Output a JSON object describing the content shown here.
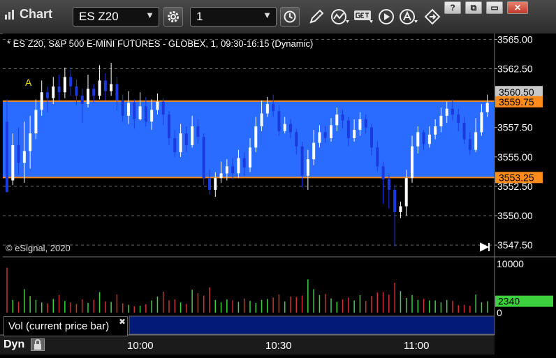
{
  "app": {
    "title": "Chart"
  },
  "toolbar": {
    "symbol": "ES Z20",
    "interval": "1"
  },
  "window_controls": [
    "?",
    "⧉",
    "▭",
    "✕"
  ],
  "chart": {
    "header": "* ES Z20, S&P 500 E-MINI FUTURES - GLOBEX, 1, 09:30-16:15 (Dynamic)",
    "copyright": "© eSignal, 2020",
    "marker_label": "A",
    "price_ticks": [
      "3565.00",
      "3562.50",
      "3557.50",
      "3555.00",
      "3552.50",
      "3550.00",
      "3547.50"
    ],
    "price_tick_values": [
      3565.0,
      3562.5,
      3557.5,
      3555.0,
      3552.5,
      3550.0,
      3547.5
    ],
    "badges": {
      "last": {
        "text": "3560.50",
        "value": 3560.5
      },
      "upper": {
        "text": "3559.75",
        "value": 3559.75
      },
      "lower": {
        "text": "3553.25",
        "value": 3553.25
      }
    },
    "band": {
      "high": 3559.75,
      "low": 3553.25,
      "color": "#2a6cff",
      "border_color": "#ff8c1a"
    },
    "colors": {
      "up": "#ffffff",
      "down": "#1a3ae0",
      "vol_up": "#3ed13e",
      "vol_down": "#d03030",
      "volume_badge": "#3ed13e"
    },
    "volume": {
      "label": "Vol (current price bar)",
      "scale_top": "10000",
      "scale_bottom": "0",
      "current": "2340",
      "current_value": 2340
    },
    "time_labels": [
      "10:00",
      "10:30",
      "11:00"
    ],
    "dyn_label": "Dyn"
  },
  "chart_data": {
    "type": "candlestick",
    "y_range": [
      3546.5,
      3565.5
    ],
    "bars": [
      [
        3558,
        3552,
        3559.9,
        3553
      ],
      [
        3553,
        3556,
        3557,
        3552.6
      ],
      [
        3556,
        3554.5,
        3557.5,
        3553.5
      ],
      [
        3554.5,
        3555.5,
        3558,
        3552.8
      ],
      [
        3555.5,
        3557,
        3558.5,
        3554
      ],
      [
        3557,
        3559,
        3559.9,
        3556.5
      ],
      [
        3559,
        3560.5,
        3561.5,
        3558.5
      ],
      [
        3560.5,
        3560,
        3561,
        3558.8
      ],
      [
        3560,
        3561,
        3561.8,
        3559.5
      ],
      [
        3561,
        3560.5,
        3562,
        3559.8
      ],
      [
        3560.5,
        3561.8,
        3562.6,
        3560
      ],
      [
        3561.8,
        3561,
        3562.4,
        3560.2
      ],
      [
        3561,
        3560.2,
        3561.6,
        3559.4
      ],
      [
        3560.2,
        3559.5,
        3560.8,
        3557.9
      ],
      [
        3559.5,
        3560.8,
        3562,
        3559.2
      ],
      [
        3560.8,
        3560.2,
        3561.2,
        3559.6
      ],
      [
        3560.2,
        3561.5,
        3562.8,
        3559.9
      ],
      [
        3561.5,
        3560.6,
        3562.1,
        3559.8
      ],
      [
        3560.6,
        3561.2,
        3563,
        3560.2
      ],
      [
        3561.2,
        3559.8,
        3561.8,
        3558.9
      ],
      [
        3559.8,
        3558.5,
        3560.3,
        3558
      ],
      [
        3558.5,
        3559.6,
        3560.6,
        3557.8
      ],
      [
        3559.6,
        3558.2,
        3559.9,
        3557.4
      ],
      [
        3558.2,
        3559.3,
        3560.5,
        3558.1
      ],
      [
        3559.3,
        3558,
        3560.1,
        3557.6
      ],
      [
        3558,
        3559,
        3559.9,
        3557.3
      ],
      [
        3559,
        3559.7,
        3560.4,
        3558.6
      ],
      [
        3559.7,
        3558.6,
        3560,
        3557.7
      ],
      [
        3558.6,
        3556.6,
        3558.9,
        3556
      ],
      [
        3556.6,
        3555.4,
        3557.3,
        3555
      ],
      [
        3555.4,
        3557,
        3557.8,
        3555
      ],
      [
        3557,
        3556,
        3557.6,
        3555.4
      ],
      [
        3556,
        3557.6,
        3558.5,
        3555.8
      ],
      [
        3557.6,
        3556.7,
        3558.2,
        3556.1
      ],
      [
        3556.7,
        3553.2,
        3557,
        3552.6
      ],
      [
        3553.2,
        3552.2,
        3553.9,
        3551.8
      ],
      [
        3552.2,
        3553.2,
        3553.7,
        3551.6
      ],
      [
        3553.2,
        3553.6,
        3554.6,
        3552.8
      ],
      [
        3553.6,
        3554.2,
        3554.8,
        3553
      ],
      [
        3554.2,
        3553.6,
        3554.9,
        3553.1
      ],
      [
        3553.6,
        3554.9,
        3555.6,
        3553.2
      ],
      [
        3554.9,
        3554.1,
        3555.4,
        3553.4
      ],
      [
        3554.1,
        3555.8,
        3556.6,
        3553.7
      ],
      [
        3555.8,
        3557.6,
        3558.4,
        3555.4
      ],
      [
        3557.6,
        3558.7,
        3559.8,
        3557.2
      ],
      [
        3558.7,
        3559.5,
        3560.1,
        3558.4
      ],
      [
        3559.5,
        3558.9,
        3560.3,
        3558.4
      ],
      [
        3558.9,
        3557.2,
        3559.4,
        3556.8
      ],
      [
        3557.2,
        3557.8,
        3558.4,
        3557
      ],
      [
        3557.8,
        3557.1,
        3558.2,
        3556.6
      ],
      [
        3557.1,
        3555.9,
        3557.4,
        3555.2
      ],
      [
        3555.9,
        3553.4,
        3556.3,
        3552.4
      ],
      [
        3553.4,
        3554.8,
        3555.6,
        3552.2
      ],
      [
        3554.8,
        3556.2,
        3557.3,
        3554.3
      ],
      [
        3556.2,
        3557.1,
        3557.7,
        3555.8
      ],
      [
        3557.1,
        3556.6,
        3557.6,
        3556.2
      ],
      [
        3556.6,
        3557.7,
        3558.3,
        3556.3
      ],
      [
        3557.7,
        3558.6,
        3559.2,
        3557.2
      ],
      [
        3558.6,
        3558.1,
        3559,
        3557.4
      ],
      [
        3558.1,
        3556.6,
        3558.4,
        3555.9
      ],
      [
        3556.6,
        3557.3,
        3558.2,
        3556.3
      ],
      [
        3557.3,
        3558.2,
        3558.8,
        3556.8
      ],
      [
        3558.2,
        3557.5,
        3558.6,
        3557
      ],
      [
        3557.5,
        3555.8,
        3557.8,
        3555.1
      ],
      [
        3555.8,
        3554.2,
        3556.3,
        3553.8
      ],
      [
        3554.2,
        3553.1,
        3554.6,
        3551
      ],
      [
        3553.1,
        3552.2,
        3553.5,
        3550.6
      ],
      [
        3552.2,
        3550.3,
        3552.6,
        3547.4
      ],
      [
        3550.3,
        3550.8,
        3551.2,
        3549.8
      ],
      [
        3550.8,
        3553.2,
        3553.9,
        3550
      ],
      [
        3553.2,
        3555.9,
        3556.8,
        3552.8
      ],
      [
        3555.9,
        3557.1,
        3557.6,
        3555.3
      ],
      [
        3557.1,
        3556.1,
        3557.3,
        3555.6
      ],
      [
        3556.1,
        3556.9,
        3557.6,
        3555.8
      ],
      [
        3556.9,
        3557.6,
        3558.2,
        3556.5
      ],
      [
        3557.6,
        3558.5,
        3559.2,
        3557.1
      ],
      [
        3558.5,
        3559.1,
        3559.7,
        3557.9
      ],
      [
        3559.1,
        3558.6,
        3559.9,
        3558.1
      ],
      [
        3558.6,
        3557.9,
        3559.1,
        3557.2
      ],
      [
        3557.9,
        3556.5,
        3558.4,
        3556.1
      ],
      [
        3556.5,
        3555.6,
        3557.1,
        3555.2
      ],
      [
        3555.6,
        3557.1,
        3558.3,
        3555.4
      ],
      [
        3557.1,
        3558.8,
        3559.5,
        3556.8
      ],
      [
        3558.8,
        3559.6,
        3560.3,
        3558.4
      ]
    ],
    "volume": [
      9200,
      2600,
      2200,
      4800,
      3400,
      2600,
      2100,
      1900,
      2800,
      3600,
      2400,
      2100,
      1800,
      2700,
      2000,
      2600,
      4200,
      2300,
      2200,
      3700,
      1900,
      1600,
      1300,
      1400,
      1700,
      2500,
      3300,
      4300,
      2500,
      2700,
      2100,
      1800,
      4700,
      4000,
      3500,
      5200,
      2600,
      2100,
      2700,
      2500,
      2200,
      2900,
      2400,
      2000,
      2600,
      2800,
      3100,
      3700,
      2300,
      3300,
      3200,
      3500,
      6800,
      4800,
      3600,
      3800,
      2900,
      2200,
      2700,
      3100,
      2500,
      3600,
      2400,
      3400,
      4100,
      4200,
      3700,
      6100,
      4400,
      3000,
      3600,
      2600,
      2800,
      2500,
      2500,
      2100,
      2600,
      2400,
      1500,
      1600,
      1400,
      3700,
      2100,
      2340
    ],
    "volume_range": [
      0,
      10000
    ]
  }
}
